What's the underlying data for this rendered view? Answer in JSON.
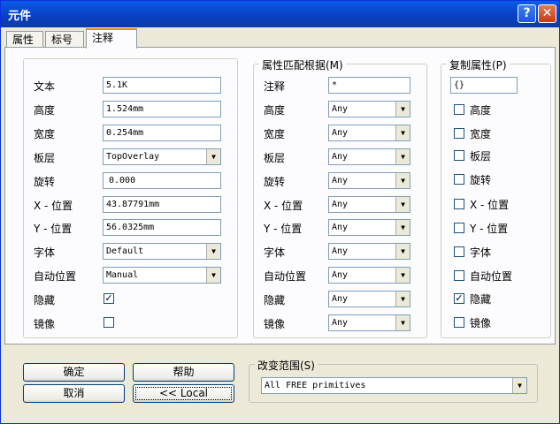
{
  "window": {
    "title": "元件"
  },
  "tabs": [
    {
      "label": "属性"
    },
    {
      "label": "标号"
    },
    {
      "label": "注释"
    }
  ],
  "properties": [
    {
      "label": "文本",
      "value": "5.1K",
      "type": "text"
    },
    {
      "label": "高度",
      "value": "1.524mm",
      "type": "text"
    },
    {
      "label": "宽度",
      "value": "0.254mm",
      "type": "text"
    },
    {
      "label": "板层",
      "value": "TopOverlay",
      "type": "combo"
    },
    {
      "label": "旋转",
      "value": "0.000",
      "type": "text"
    },
    {
      "label": "X - 位置",
      "value": "43.87791mm",
      "type": "text"
    },
    {
      "label": "Y - 位置",
      "value": "56.0325mm",
      "type": "text"
    },
    {
      "label": "字体",
      "value": "Default",
      "type": "combo"
    },
    {
      "label": "自动位置",
      "value": "Manual",
      "type": "combo"
    },
    {
      "label": "隐藏",
      "checked": true,
      "type": "check"
    },
    {
      "label": "镜像",
      "checked": false,
      "type": "check"
    }
  ],
  "match_group": {
    "title": "属性匹配根据(M)",
    "rows": [
      {
        "label": "注释",
        "value": "*",
        "type": "text"
      },
      {
        "label": "高度",
        "value": "Any"
      },
      {
        "label": "宽度",
        "value": "Any"
      },
      {
        "label": "板层",
        "value": "Any"
      },
      {
        "label": "旋转",
        "value": "Any"
      },
      {
        "label": "X - 位置",
        "value": "Any"
      },
      {
        "label": "Y - 位置",
        "value": "Any"
      },
      {
        "label": "字体",
        "value": "Any"
      },
      {
        "label": "自动位置",
        "value": "Any"
      },
      {
        "label": "隐藏",
        "value": "Any"
      },
      {
        "label": "镜像",
        "value": "Any"
      }
    ]
  },
  "copy_group": {
    "title": "复制属性(P)",
    "field_value": "{}",
    "items": [
      {
        "label": "高度",
        "checked": false
      },
      {
        "label": "宽度",
        "checked": false
      },
      {
        "label": "板层",
        "checked": false
      },
      {
        "label": "旋转",
        "checked": false
      },
      {
        "label": "X - 位置",
        "checked": false
      },
      {
        "label": "Y - 位置",
        "checked": false
      },
      {
        "label": "字体",
        "checked": false
      },
      {
        "label": "自动位置",
        "checked": false
      },
      {
        "label": "隐藏",
        "checked": true
      },
      {
        "label": "镜像",
        "checked": false
      }
    ]
  },
  "buttons": {
    "ok": "确定",
    "help": "帮助",
    "cancel": "取消",
    "local": "<< Local"
  },
  "scope": {
    "title": "改变范围(S)",
    "value": "All FREE primitives"
  },
  "icons": {
    "help": "?",
    "close": "✕",
    "arrow": "▼",
    "check": "✓"
  }
}
